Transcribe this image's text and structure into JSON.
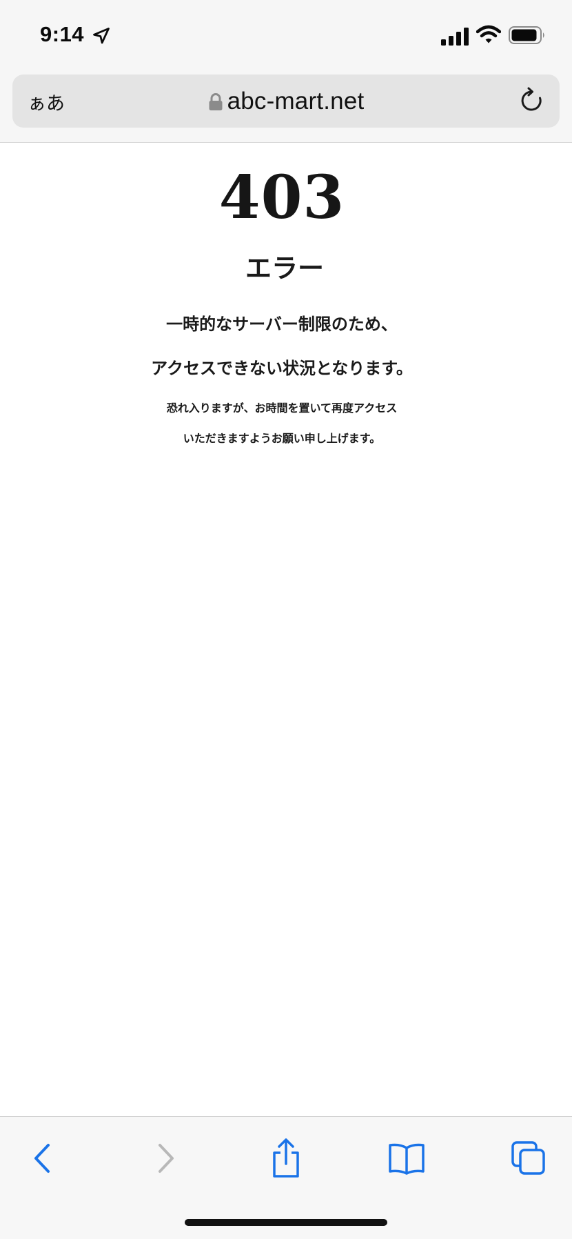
{
  "status_bar": {
    "time": "9:14",
    "icons": [
      "location-arrow-icon",
      "cellular-signal-icon",
      "wifi-icon",
      "battery-icon"
    ]
  },
  "address_bar": {
    "text_size_label": "ぁあ",
    "url": "abc-mart.net",
    "icons": [
      "lock-icon",
      "reload-icon"
    ]
  },
  "page": {
    "error_code": "403",
    "error_title": "エラー",
    "message_line_1": "一時的なサーバー制限のため、",
    "message_line_2": "アクセスできない状況となります。",
    "sub_line_1": "恐れ入りますが、お時間を置いて再度アクセス",
    "sub_line_2": "いただきますようお願い申し上げます。"
  },
  "toolbar": {
    "icons": [
      "back-icon",
      "forward-icon",
      "share-icon",
      "bookmarks-icon",
      "tabs-icon"
    ],
    "back_enabled": true,
    "forward_enabled": false
  },
  "colors": {
    "accent": "#1a73e8",
    "disabled": "#b8b8b8",
    "bar_background": "#f6f6f6",
    "address_pill": "#e4e4e4"
  }
}
